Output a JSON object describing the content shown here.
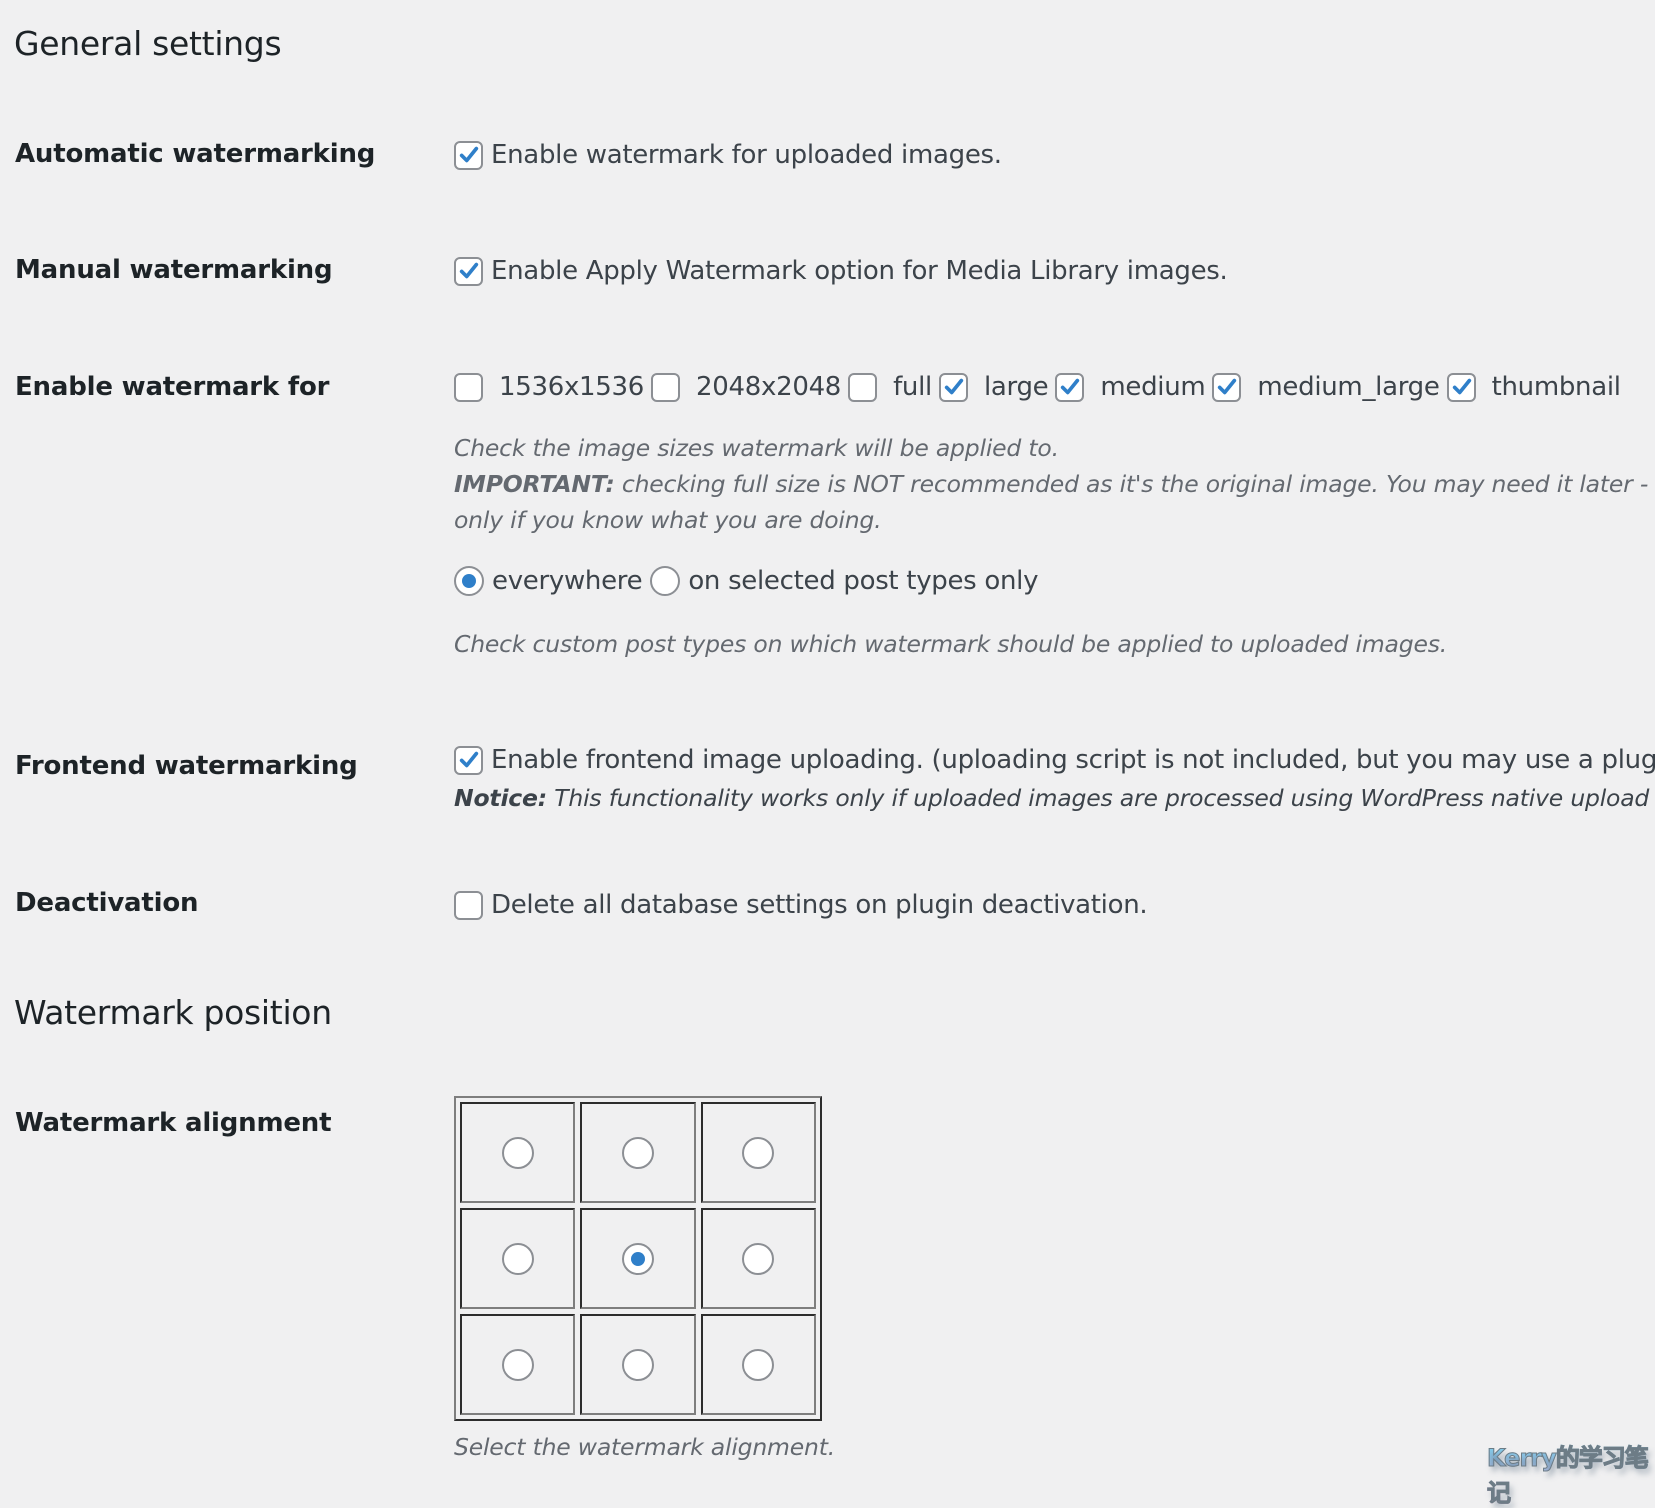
{
  "general": {
    "title": "General settings",
    "automatic": {
      "label": "Automatic watermarking",
      "checkbox_label": "Enable watermark for uploaded images.",
      "checked": true
    },
    "manual": {
      "label": "Manual watermarking",
      "checkbox_label": "Enable Apply Watermark option for Media Library images.",
      "checked": true
    },
    "enable_for": {
      "label": "Enable watermark for",
      "sizes": [
        {
          "name": "1536x1536",
          "checked": false
        },
        {
          "name": "2048x2048",
          "checked": false
        },
        {
          "name": "full",
          "checked": false
        },
        {
          "name": "large",
          "checked": true
        },
        {
          "name": "medium",
          "checked": true
        },
        {
          "name": "medium_large",
          "checked": true
        },
        {
          "name": "thumbnail",
          "checked": true
        }
      ],
      "help_line1": "Check the image sizes watermark will be applied to.",
      "help_important_prefix": "IMPORTANT:",
      "help_important_text": " checking full size is NOT recommended as it's the original image. You may need it later - for r",
      "help_line3": "only if you know what you are doing.",
      "post_type_options": [
        {
          "label": "everywhere",
          "selected": true
        },
        {
          "label": "on selected post types only",
          "selected": false
        }
      ],
      "post_type_help": "Check custom post types on which watermark should be applied to uploaded images."
    },
    "frontend": {
      "label": "Frontend watermarking",
      "checkbox_label": "Enable frontend image uploading. (uploading script is not included, but you may use a plugin",
      "checked": true,
      "notice_prefix": "Notice:",
      "notice_text": " This functionality works only if uploaded images are processed using WordPress native upload meth"
    },
    "deactivation": {
      "label": "Deactivation",
      "checkbox_label": "Delete all database settings on plugin deactivation.",
      "checked": false
    }
  },
  "position": {
    "title": "Watermark position",
    "alignment": {
      "label": "Watermark alignment",
      "options": [
        "top_left",
        "top_center",
        "top_right",
        "middle_left",
        "middle_center",
        "middle_right",
        "bottom_left",
        "bottom_center",
        "bottom_right"
      ],
      "selected": "middle_center",
      "help": "Select the watermark alignment."
    }
  },
  "overlay": {
    "watermark_text": "Kerry的学习笔记"
  },
  "colors": {
    "accent": "#2f7fc9",
    "background": "#f0f0f1",
    "text": "#1d2327",
    "help_text": "#646970"
  }
}
